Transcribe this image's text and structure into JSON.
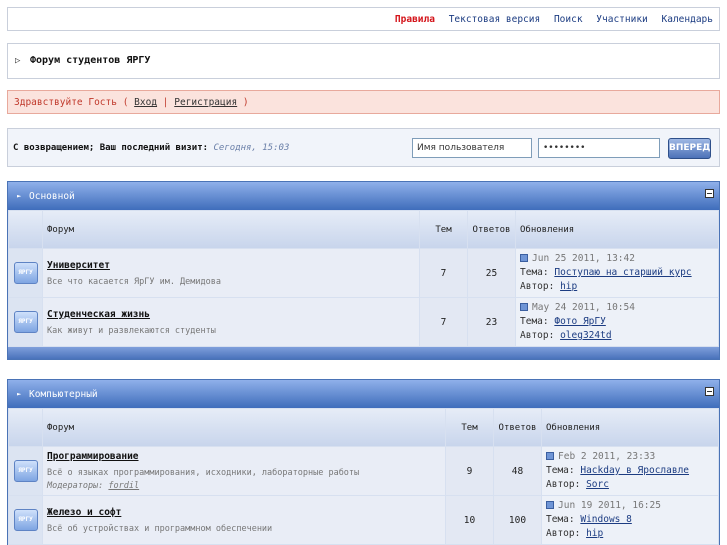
{
  "nav": {
    "rules": "Правила",
    "text_version": "Текстовая версия",
    "search": "Поиск",
    "members": "Участники",
    "calendar": "Календарь"
  },
  "board": {
    "title": "Форум студентов ЯРГУ"
  },
  "guest": {
    "greeting": "Здравствуйте Гость",
    "open": "(",
    "login": "Вход",
    "sep": "|",
    "register": "Регистрация",
    "close": ")"
  },
  "login_bar": {
    "welcome": "С возвращением; Ваш последний визит:",
    "last_visit": "Сегодня, 15:03",
    "username_value": "Имя пользователя",
    "password_value": "••••••••",
    "submit": "ВПЕРЕД"
  },
  "categories": [
    {
      "name": "Основной",
      "columns": {
        "forum": "Форум",
        "topics": "Тем",
        "replies": "Ответов",
        "updates": "Обновления"
      },
      "forums": [
        {
          "icon": "ЯРГУ",
          "name": "Университет",
          "desc": "Все что касается ЯрГУ им. Демидова",
          "moderators_label": "",
          "moderator": "",
          "topics": "7",
          "replies": "25",
          "date": "Jun 25 2011, 13:42",
          "topic_label": "Тема:",
          "topic": "Поступаю на старший курс",
          "author_label": "Автор:",
          "author": "hip"
        },
        {
          "icon": "ЯРГУ",
          "name": "Студенческая жизнь",
          "desc": "Как живут и развлекаются студенты",
          "moderators_label": "",
          "moderator": "",
          "topics": "7",
          "replies": "23",
          "date": "May 24 2011, 10:54",
          "topic_label": "Тема:",
          "topic": "Фото ЯрГУ",
          "author_label": "Автор:",
          "author": "oleg324td"
        }
      ]
    },
    {
      "name": "Компьютерный",
      "columns": {
        "forum": "Форум",
        "topics": "Тем",
        "replies": "Ответов",
        "updates": "Обновления"
      },
      "forums": [
        {
          "icon": "ЯРГУ",
          "name": "Программирование",
          "desc": "Всё о языках программирования, исходники, лабораторные работы",
          "moderators_label": "Модераторы:",
          "moderator": "fordil",
          "topics": "9",
          "replies": "48",
          "date": "Feb 2 2011, 23:33",
          "topic_label": "Тема:",
          "topic": "Hackday в Ярославле",
          "author_label": "Автор:",
          "author": "Sorc"
        },
        {
          "icon": "ЯРГУ",
          "name": "Железо и софт",
          "desc": "Всё об устройствах и программном обеспечении",
          "moderators_label": "",
          "moderator": "",
          "topics": "10",
          "replies": "100",
          "date": "Jun 19 2011, 16:25",
          "topic_label": "Тема:",
          "topic": "Windows 8",
          "author_label": "Автор:",
          "author": "hip"
        }
      ]
    }
  ],
  "colors": {
    "accent": "#3f6dbb",
    "rules_link": "#d4141a",
    "guest_bg": "#fbe3dd"
  }
}
